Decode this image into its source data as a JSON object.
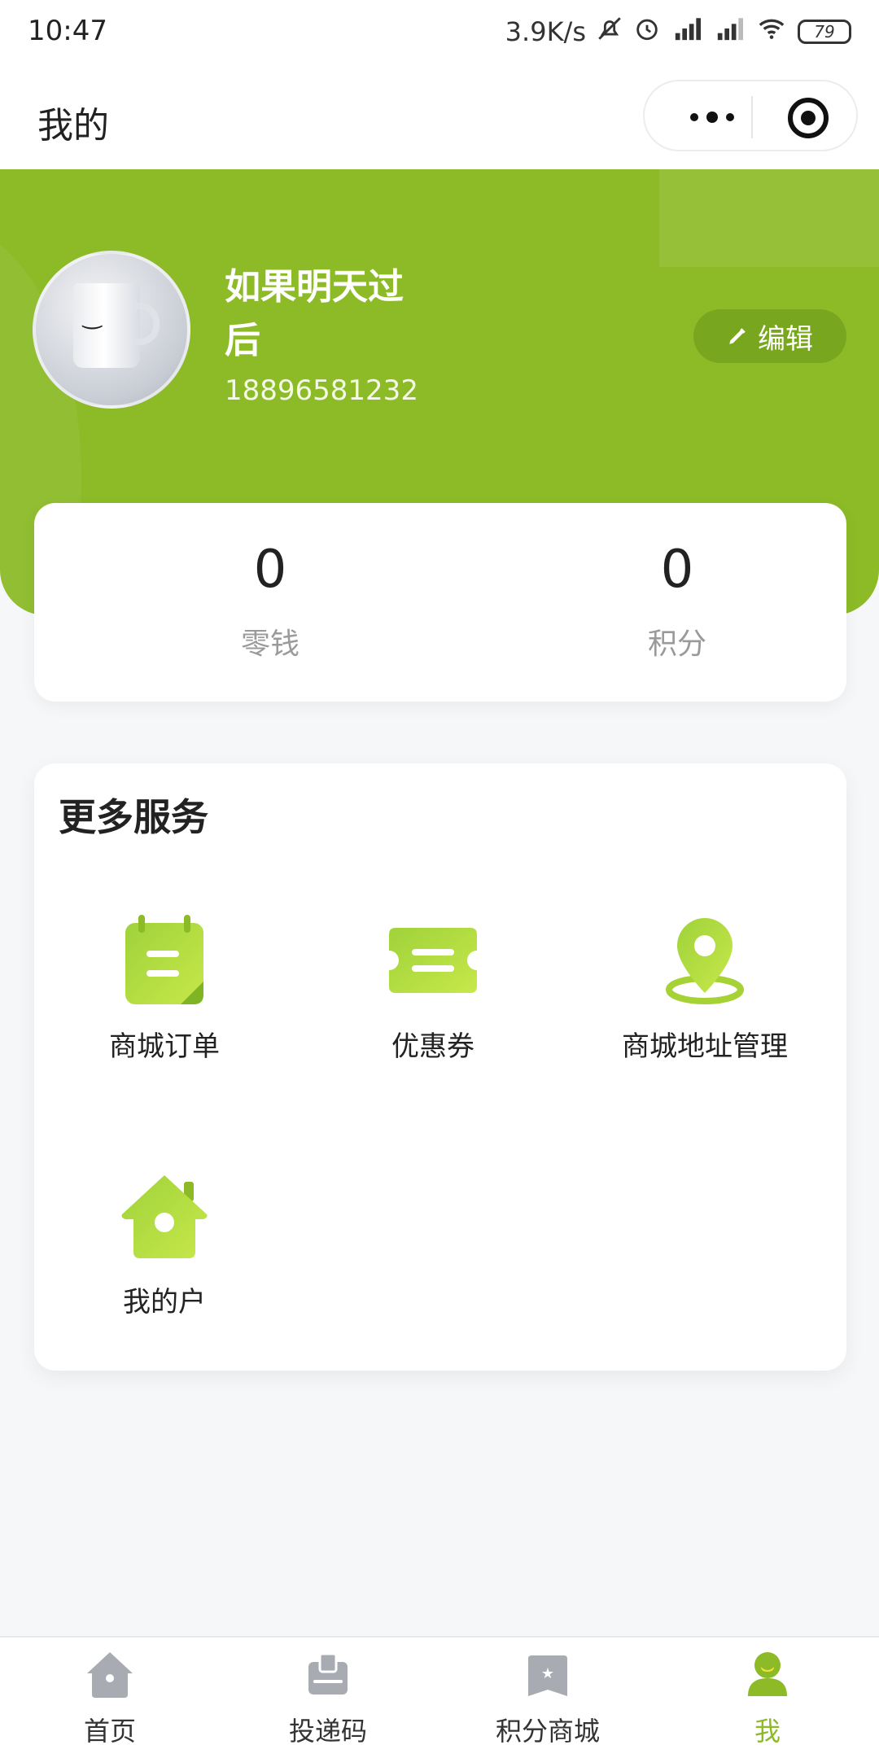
{
  "status_bar": {
    "time": "10:47",
    "net_speed": "3.9K/s",
    "icons": [
      "bell-off-icon",
      "alarm-icon",
      "hd-signal-icon",
      "signal-icon",
      "wifi-icon"
    ],
    "battery": "79"
  },
  "nav": {
    "title": "我的",
    "more_icon": "more-dots-icon",
    "close_icon": "target-icon"
  },
  "profile": {
    "username": "如果明天过后",
    "phone": "18896581232",
    "edit_label": "编辑",
    "avatar_caption": "Smile"
  },
  "balance": {
    "items": [
      {
        "value": "0",
        "label": "零钱"
      },
      {
        "value": "0",
        "label": "积分"
      }
    ]
  },
  "services": {
    "title": "更多服务",
    "items": [
      {
        "label": "商城订单",
        "icon": "calendar-order-icon"
      },
      {
        "label": "优惠券",
        "icon": "coupon-icon"
      },
      {
        "label": "商城地址管理",
        "icon": "location-pin-icon"
      },
      {
        "label": "我的户",
        "icon": "house-icon"
      }
    ]
  },
  "tabbar": {
    "items": [
      {
        "label": "首页",
        "icon": "home-icon",
        "active": false
      },
      {
        "label": "投递码",
        "icon": "delivery-box-icon",
        "active": false
      },
      {
        "label": "积分商城",
        "icon": "points-mall-icon",
        "active": false
      },
      {
        "label": "我",
        "icon": "user-icon",
        "active": true
      }
    ]
  },
  "colors": {
    "brand": "#8cbb27",
    "inactive_icon": "#a9abb3",
    "text": "#222222"
  }
}
